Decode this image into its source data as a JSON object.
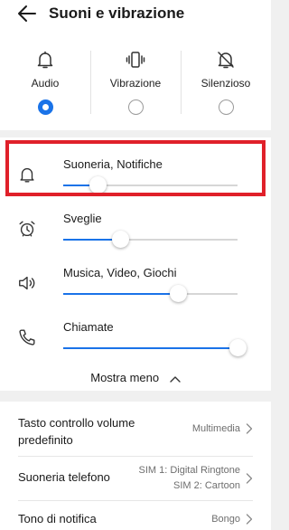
{
  "header": {
    "title": "Suoni e vibrazione"
  },
  "modes": [
    {
      "label": "Audio",
      "icon": "bell-icon",
      "checked": true
    },
    {
      "label": "Vibrazione",
      "icon": "vibration-icon",
      "checked": false
    },
    {
      "label": "Silenzioso",
      "icon": "bell-off-icon",
      "checked": false
    }
  ],
  "volumes": [
    {
      "label": "Suoneria, Notifiche",
      "icon": "bell-icon",
      "level": 0.2
    },
    {
      "label": "Sveglie",
      "icon": "alarm-clock-icon",
      "level": 0.33
    },
    {
      "label": "Musica, Video, Giochi",
      "icon": "speaker-icon",
      "level": 0.66
    },
    {
      "label": "Chiamate",
      "icon": "phone-icon",
      "level": 1.0
    }
  ],
  "show_less": "Mostra meno",
  "settings": [
    {
      "label": "Tasto controllo volume predefinito",
      "value": "Multimedia"
    },
    {
      "label": "Suoneria telefono",
      "value_line1": "SIM 1: Digital Ringtone",
      "value_line2": "SIM 2: Cartoon"
    },
    {
      "label": "Tono di notifica",
      "value": "Bongo"
    }
  ],
  "colors": {
    "accent": "#1a73e8",
    "highlight": "#e0202a"
  }
}
